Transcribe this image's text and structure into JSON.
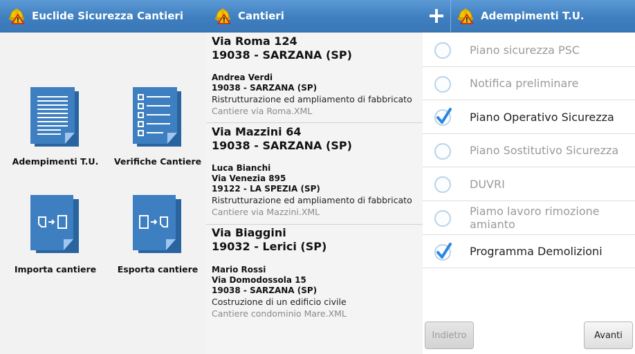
{
  "screen1": {
    "title": "Euclide Sicurezza Cantieri",
    "menu": [
      {
        "label": "Adempimenti T.U.",
        "icon": "document-lines-icon"
      },
      {
        "label": "Verifiche Cantiere",
        "icon": "checklist-icon"
      },
      {
        "label": "Importa cantiere",
        "icon": "import-icon"
      },
      {
        "label": "Esporta cantiere",
        "icon": "export-icon"
      }
    ]
  },
  "screen2": {
    "title": "Cantieri",
    "sites": [
      {
        "address": "Via Roma 124",
        "city": "19038 - SARZANA (SP)",
        "contact_lines": [
          "Andrea Verdi",
          "19038 - SARZANA (SP)"
        ],
        "description": "Ristrutturazione ed ampliamento di fabbricato",
        "file": "Cantiere via Roma.XML"
      },
      {
        "address": "Via Mazzini 64",
        "city": "19038 - SARZANA (SP)",
        "contact_lines": [
          "Luca Bianchi",
          "Via Venezia 895",
          "19122 - LA SPEZIA (SP)"
        ],
        "description": "Ristrutturazione ed ampliamento di fabbricato",
        "file": "Cantiere via Mazzini.XML"
      },
      {
        "address": "Via Biaggini",
        "city": "19032 - Lerici (SP)",
        "contact_lines": [
          "Mario Rossi",
          "Via Domodossola 15",
          "19038 - SARZANA (SP)"
        ],
        "description": "Costruzione di un edificio civile",
        "file": "Cantiere condominio Mare.XML"
      }
    ]
  },
  "screen3": {
    "title": "Adempimenti T.U.",
    "add_icon": "plus-icon",
    "items": [
      {
        "label": "Piano sicurezza PSC",
        "checked": false
      },
      {
        "label": "Notifica preliminare",
        "checked": false
      },
      {
        "label": "Piano Operativo Sicurezza",
        "checked": true
      },
      {
        "label": "Piano Sostitutivo Sicurezza",
        "checked": false
      },
      {
        "label": "DUVRI",
        "checked": false
      },
      {
        "label": "Piamo lavoro rimozione amianto",
        "checked": false
      },
      {
        "label": "Programma Demolizioni",
        "checked": true
      }
    ],
    "back_label": "Indietro",
    "next_label": "Avanti"
  },
  "colors": {
    "actionbar": "#3f7fbf",
    "icon_blue": "#3d7fc0",
    "check_blue": "#2b86e0"
  }
}
